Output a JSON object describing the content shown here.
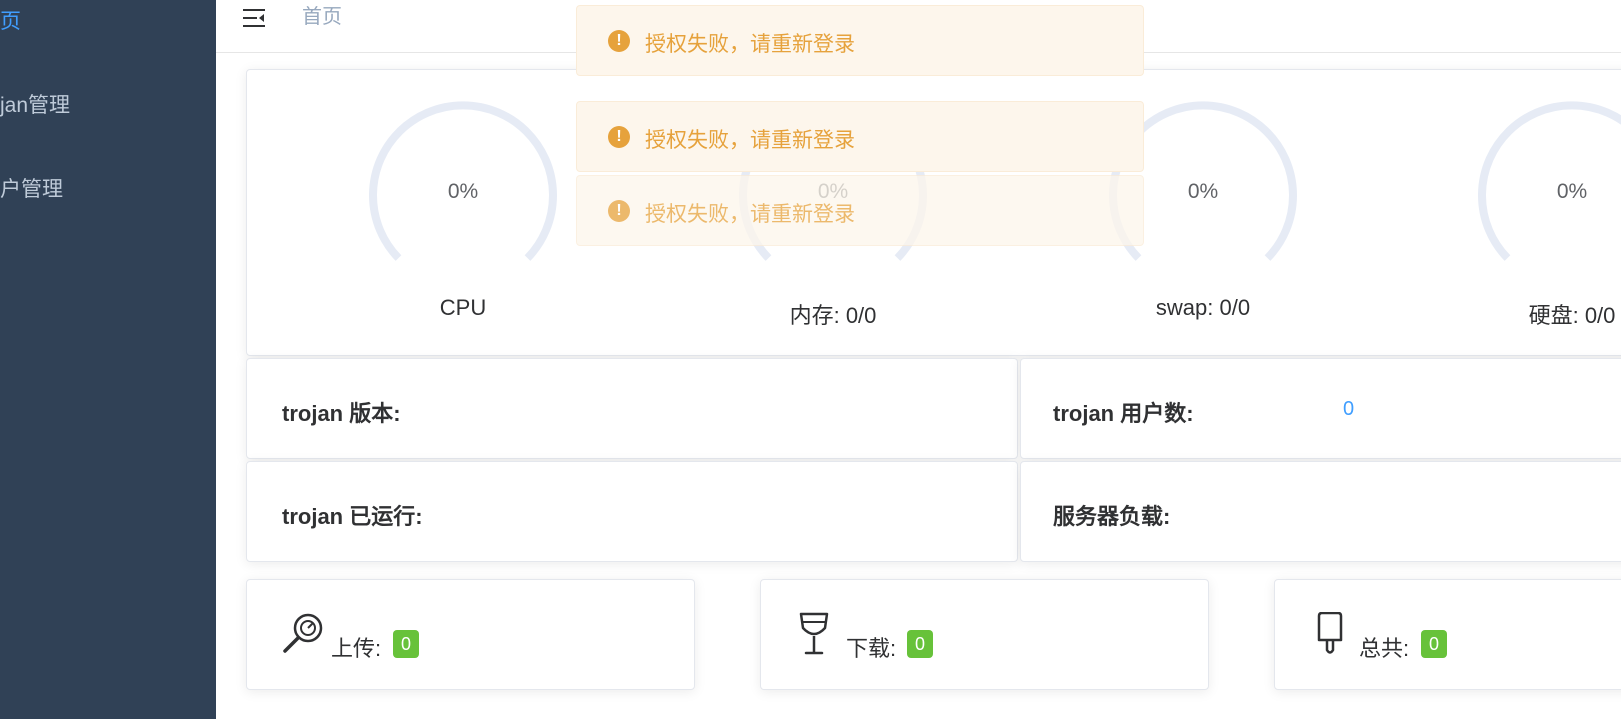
{
  "sidebar": {
    "items": [
      {
        "label": "页"
      },
      {
        "label": "jan管理"
      },
      {
        "label": "户管理"
      }
    ]
  },
  "header": {
    "breadcrumb": "首页"
  },
  "gauges": [
    {
      "value": "0%",
      "label": "CPU"
    },
    {
      "value": "0%",
      "label": "内存: 0/0"
    },
    {
      "value": "0%",
      "label": "swap: 0/0"
    },
    {
      "value": "0%",
      "label": "硬盘: 0/0"
    }
  ],
  "info": {
    "version_label": "trojan 版本:",
    "users_label": "trojan 用户数:",
    "users_value": "0",
    "uptime_label": "trojan 已运行:",
    "load_label": "服务器负载:"
  },
  "stats": [
    {
      "label": "上传:",
      "value": "0",
      "icon": "lollipop-icon"
    },
    {
      "label": "下载:",
      "value": "0",
      "icon": "wine-glass-icon"
    },
    {
      "label": "总共:",
      "value": "0",
      "icon": "popsicle-icon"
    }
  ],
  "toasts": [
    {
      "text": "授权失败，请重新登录"
    },
    {
      "text": "授权失败，请重新登录"
    },
    {
      "text": "授权失败，请重新登录"
    }
  ],
  "colors": {
    "sidebar_bg": "#304156",
    "accent": "#409eff",
    "warning": "#e6a23c",
    "success": "#67c23a"
  }
}
